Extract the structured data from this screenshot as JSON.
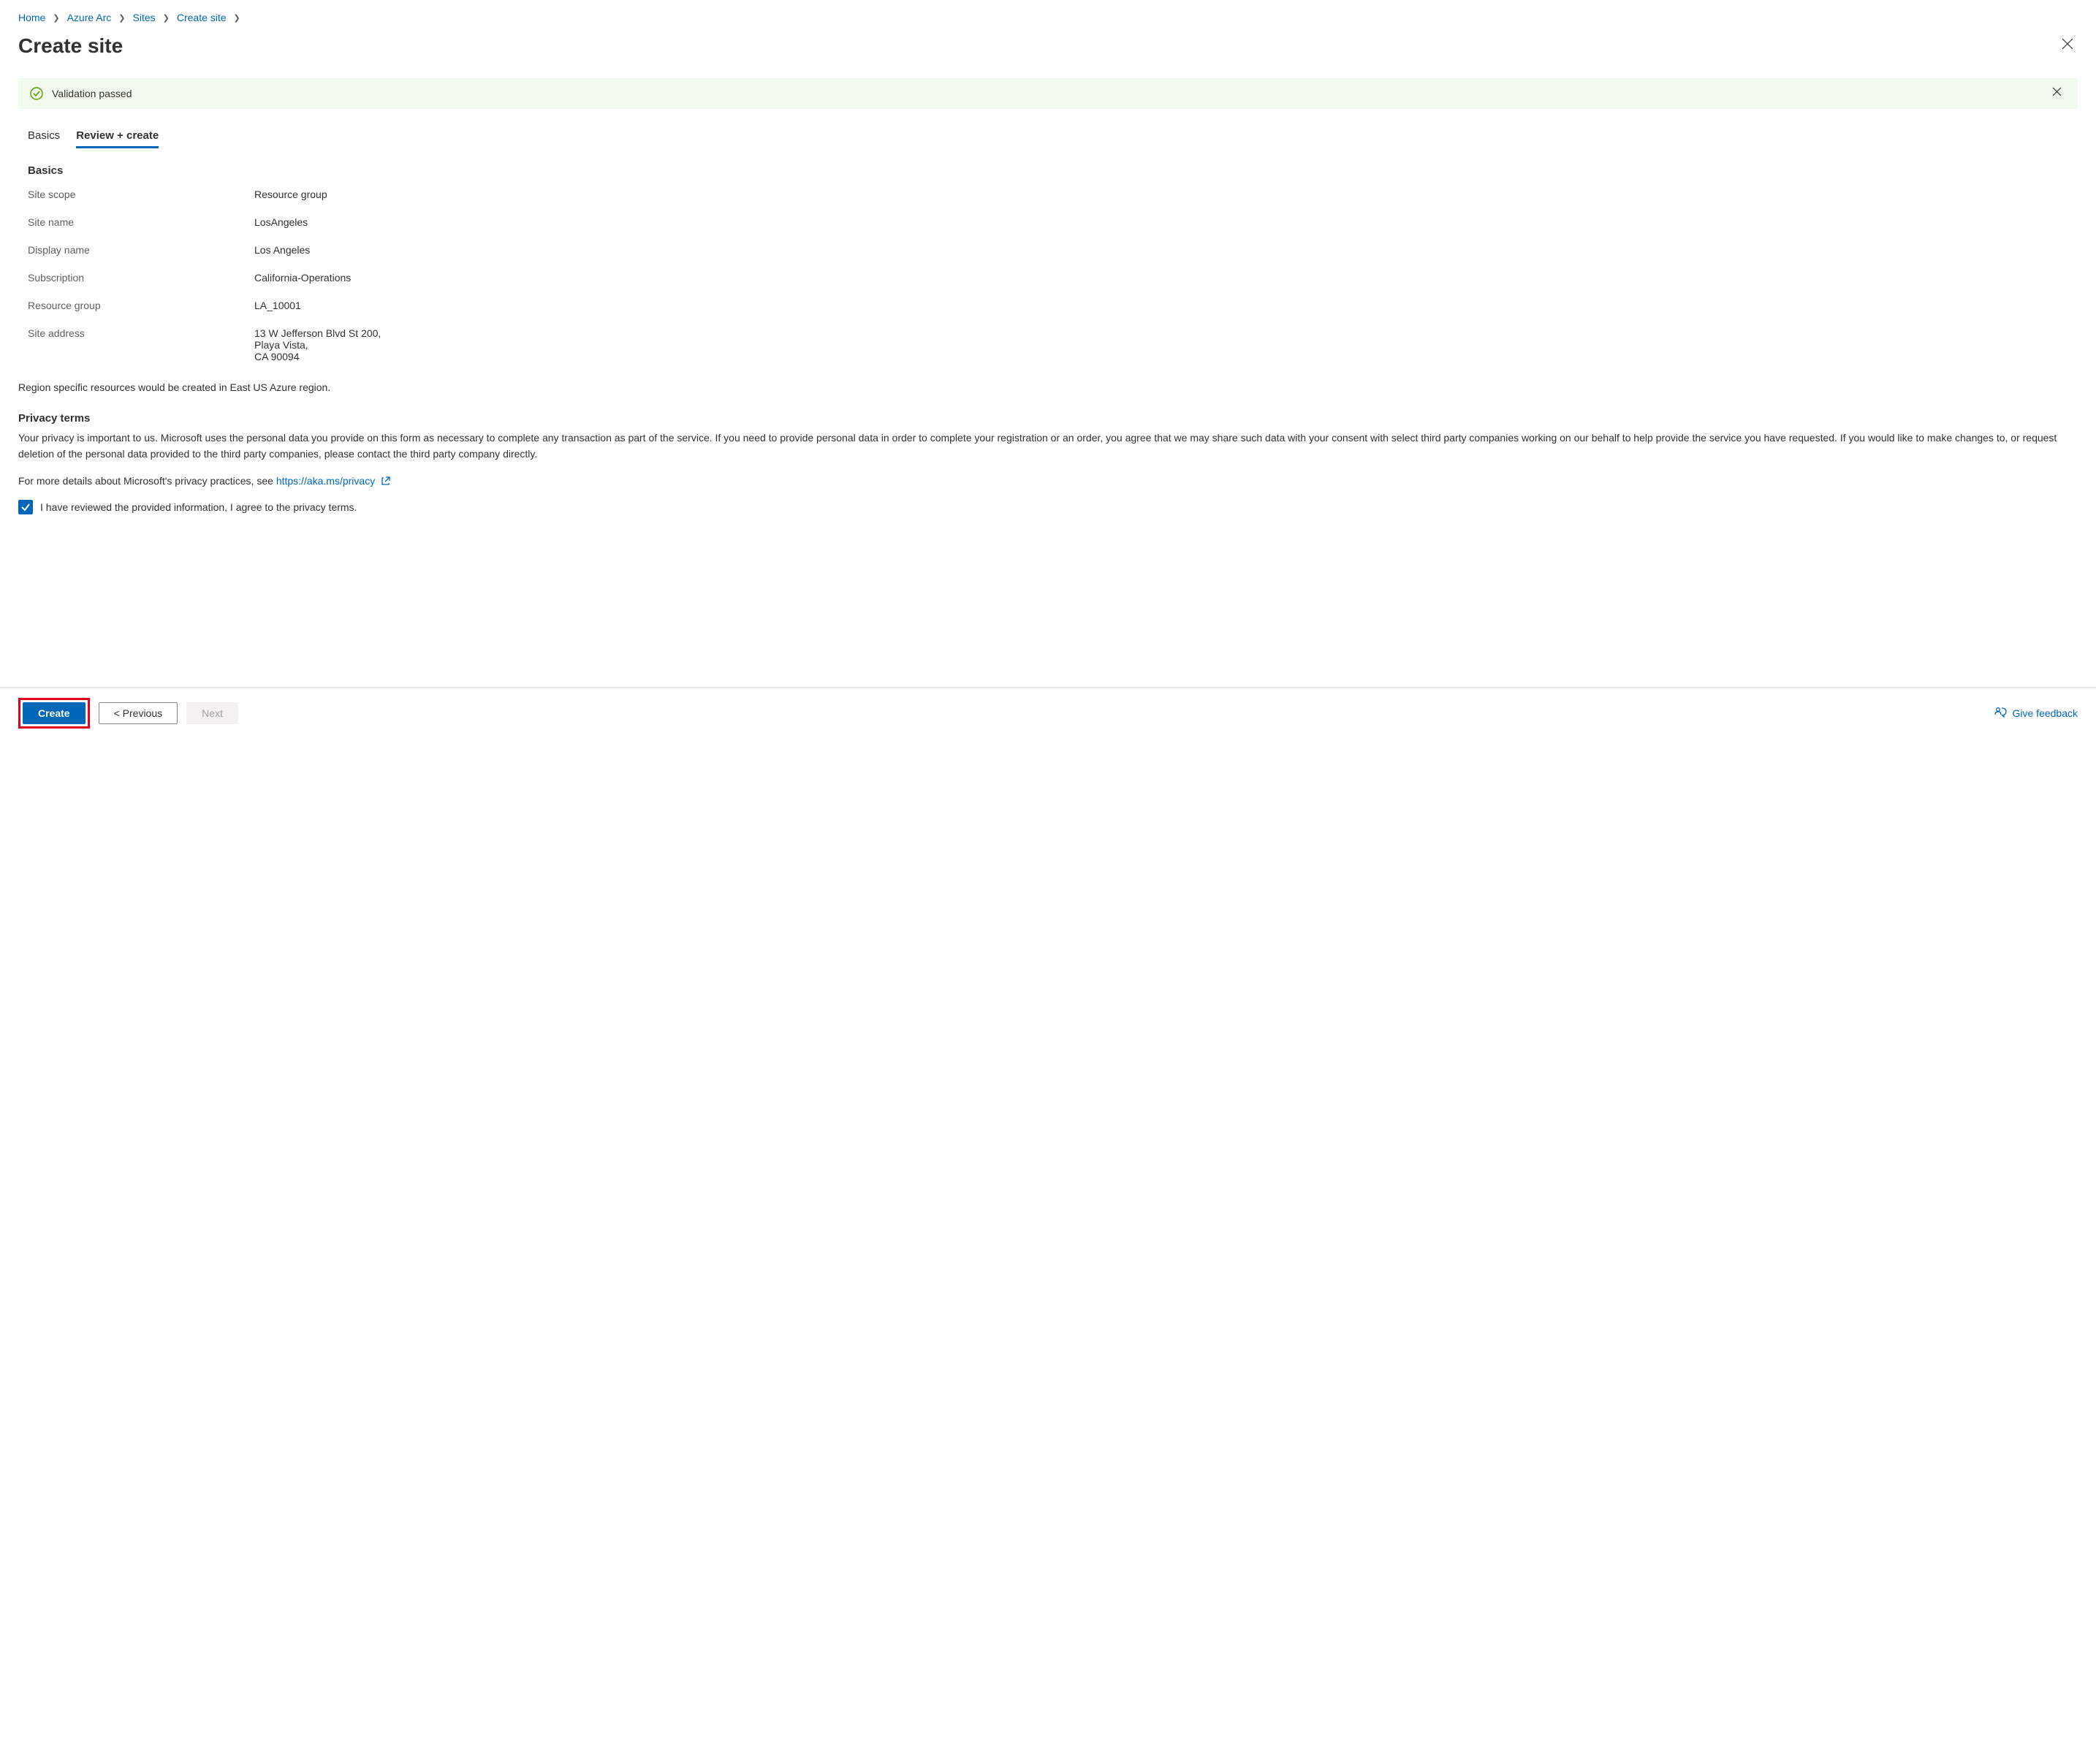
{
  "breadcrumb": {
    "items": [
      {
        "label": "Home"
      },
      {
        "label": "Azure Arc"
      },
      {
        "label": "Sites"
      },
      {
        "label": "Create site"
      }
    ]
  },
  "page": {
    "title": "Create site"
  },
  "banner": {
    "message": "Validation passed"
  },
  "tabs": {
    "items": [
      {
        "label": "Basics",
        "active": false
      },
      {
        "label": "Review + create",
        "active": true
      }
    ]
  },
  "basics": {
    "heading": "Basics",
    "rows": [
      {
        "label": "Site scope",
        "value": "Resource group"
      },
      {
        "label": "Site name",
        "value": "LosAngeles"
      },
      {
        "label": "Display name",
        "value": "Los Angeles"
      },
      {
        "label": "Subscription",
        "value": "California-Operations"
      },
      {
        "label": "Resource group",
        "value": "LA_10001"
      },
      {
        "label": "Site address",
        "value": "13 W Jefferson Blvd St 200,\nPlaya Vista,\nCA 90094"
      }
    ]
  },
  "region_note": "Region specific resources would be created in East US Azure region.",
  "privacy": {
    "heading": "Privacy terms",
    "body": "Your privacy is important to us. Microsoft uses the personal data you provide on this form as necessary to complete any transaction as part of the service. If you need to provide personal data in order to complete your registration or an order, you agree that we may share such data with your consent with select third party companies working on our behalf to help provide the service you have requested. If you would like to make changes to, or request deletion of the personal data provided to the third party companies, please contact the third party company directly.",
    "more_prefix": "For more details about Microsoft's privacy practices, see ",
    "link_text": "https://aka.ms/privacy",
    "checkbox_label": "I have reviewed the provided information, I agree to the privacy terms."
  },
  "footer": {
    "create": "Create",
    "previous": "< Previous",
    "next": "Next",
    "feedback": "Give feedback"
  }
}
